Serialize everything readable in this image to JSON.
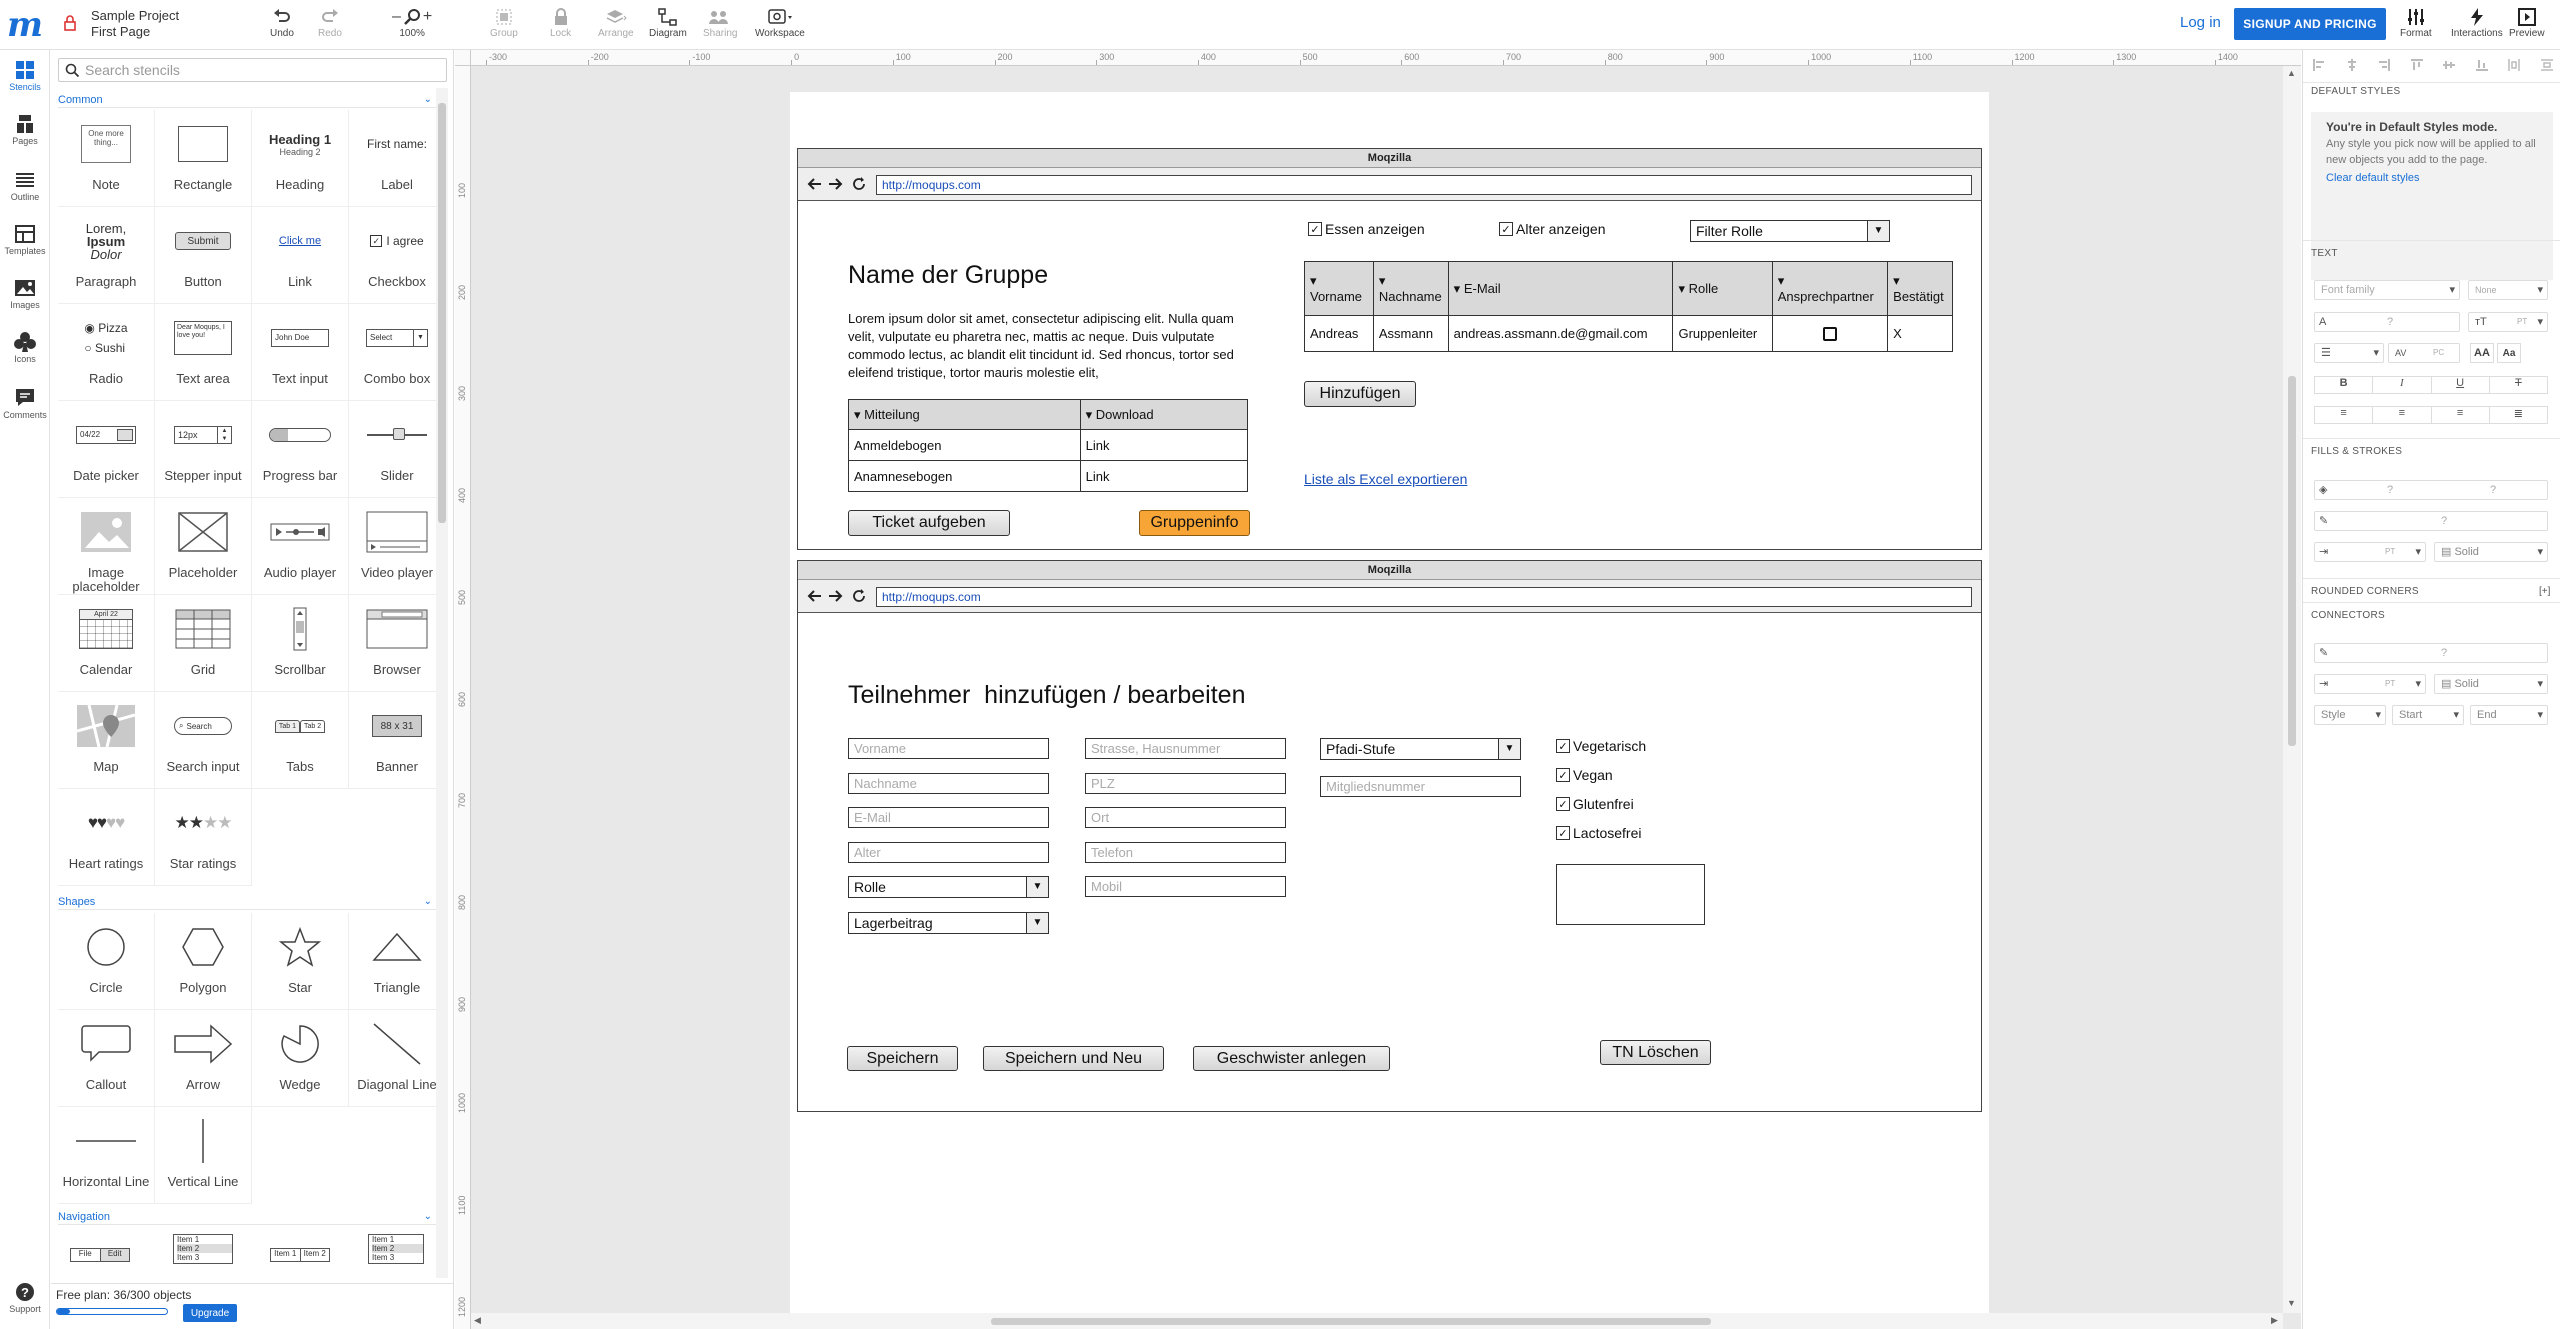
{
  "app": {
    "project_name": "Sample Project",
    "page_name": "First Page"
  },
  "toolbar": {
    "undo": "Undo",
    "redo": "Redo",
    "zoom": "100%",
    "group": "Group",
    "lock": "Lock",
    "arrange": "Arrange",
    "diagram": "Diagram",
    "sharing": "Sharing",
    "workspace": "Workspace",
    "login": "Log in",
    "signup": "SIGNUP AND PRICING",
    "format": "Format",
    "interactions": "Interactions",
    "preview": "Preview"
  },
  "rail": {
    "stencils": "Stencils",
    "pages": "Pages",
    "outline": "Outline",
    "templates": "Templates",
    "images": "Images",
    "icons": "Icons",
    "comments": "Comments",
    "support": "Support"
  },
  "stencils": {
    "search_placeholder": "Search stencils",
    "sections": {
      "common": "Common",
      "shapes": "Shapes",
      "navigation": "Navigation"
    },
    "common": [
      "Note",
      "Rectangle",
      "Heading",
      "Label",
      "Paragraph",
      "Button",
      "Link",
      "Checkbox",
      "Radio",
      "Text area",
      "Text input",
      "Combo box",
      "Date picker",
      "Stepper input",
      "Progress bar",
      "Slider",
      "Image placeholder",
      "Placeholder",
      "Audio player",
      "Video player",
      "Calendar",
      "Grid",
      "Scrollbar",
      "Browser",
      "Map",
      "Search input",
      "Tabs",
      "Banner",
      "Heart ratings",
      "Star ratings"
    ],
    "shapes": [
      "Circle",
      "Polygon",
      "Star",
      "Triangle",
      "Callout",
      "Arrow",
      "Wedge",
      "Diagonal Line",
      "Horizontal Line",
      "Vertical Line"
    ],
    "thumbs": {
      "note": "One more thing...",
      "heading1": "Heading 1",
      "heading2": "Heading 2",
      "label": "First name:",
      "para1": "Lorem,",
      "para2": "Ipsum",
      "para3": "Dolor",
      "button": "Submit",
      "link": "Click me",
      "checkbox": "I agree",
      "radio1": "Pizza",
      "radio2": "Sushi",
      "textarea": "Dear Moqups, I love you!",
      "textinput": "John Doe",
      "combo": "Select",
      "date": "04/22",
      "stepper": "12px",
      "calendar": "April 22",
      "search": "Search",
      "tab1": "Tab 1",
      "tab2": "Tab 2",
      "banner": "88 x 31",
      "nav_file": "File",
      "nav_edit": "Edit",
      "nav_item1": "Item 1",
      "nav_item2": "Item 2",
      "nav_item3": "Item 3"
    }
  },
  "plan": {
    "text": "Free plan: 36/300 objects",
    "progress": 0.12,
    "upgrade": "Upgrade"
  },
  "rulers": {
    "top": [
      "-300",
      "-200",
      "-100",
      "0",
      "100",
      "200",
      "300",
      "400",
      "500",
      "600",
      "700",
      "800",
      "900",
      "1000",
      "1100",
      "1200",
      "1300",
      "1400"
    ],
    "left": [
      "100",
      "200",
      "300",
      "400",
      "500",
      "600",
      "700",
      "800",
      "900",
      "1000",
      "1100",
      "1200"
    ]
  },
  "right_panel": {
    "default_styles": "DEFAULT STYLES",
    "mode_title": "You're in Default Styles mode.",
    "mode_desc": "Any style you pick now will be applied to all new objects you add to the page.",
    "clear": "Clear default styles",
    "text": "TEXT",
    "font_family": "Font family",
    "font_none": "None",
    "q": "?",
    "pt": "PT",
    "pc": "PC",
    "fills": "FILLS & STROKES",
    "solid": "Solid",
    "rounded": "ROUNDED CORNERS",
    "rounded_add": "[+]",
    "connectors": "CONNECTORS",
    "style": "Style",
    "start": "Start",
    "end": "End"
  },
  "wire1": {
    "title": "Moqzilla",
    "url": "http://moqups.com",
    "heading": "Name der Gruppe",
    "lorem": "Lorem ipsum dolor sit amet, consectetur adipiscing elit. Nulla quam velit, vulputate eu pharetra nec, mattis ac neque. Duis vulputate commodo lectus, ac blandit elit tincidunt id. Sed rhoncus, tortor sed eleifend tristique, tortor mauris molestie elit,",
    "docs_headers": [
      "Mitteilung",
      "Download"
    ],
    "docs_rows": [
      [
        "Anmeldebogen",
        "Link"
      ],
      [
        "Anamnesebogen",
        "Link"
      ]
    ],
    "btn_ticket": "Ticket aufgeben",
    "btn_info": "Gruppeninfo",
    "chk_essen": "Essen anzeigen",
    "chk_alter": "Alter anzeigen",
    "filter": "Filter Rolle",
    "member_headers": [
      "Vorname",
      "Nachname",
      "E-Mail",
      "Rolle",
      "Ansprechpartner",
      "Bestätigt"
    ],
    "member_row": [
      "Andreas",
      "Assmann",
      "andreas.assmann.de@gmail.com",
      "Gruppenleiter",
      "",
      "X"
    ],
    "btn_add": "Hinzufügen",
    "export": "Liste als Excel exportieren"
  },
  "wire2": {
    "title": "Moqzilla",
    "url": "http://moqups.com",
    "heading": "Teilnehmer  hinzufügen / bearbeiten",
    "col1": [
      "Vorname",
      "Nachname",
      "E-Mail",
      "Alter"
    ],
    "col2": [
      "Strasse, Hausnummer",
      "PLZ",
      "Ort",
      "Telefon",
      "Mobil"
    ],
    "sel_rolle": "Rolle",
    "sel_lager": "Lagerbeitrag",
    "sel_stufe": "Pfadi-Stufe",
    "mitglied": "Mitgliedsnummer",
    "diets": [
      "Vegetarisch",
      "Vegan",
      "Glutenfrei",
      "Lactosefrei"
    ],
    "btn_save": "Speichern",
    "btn_save_new": "Speichern und Neu",
    "btn_sibling": "Geschwister anlegen",
    "btn_delete": "TN Löschen"
  }
}
